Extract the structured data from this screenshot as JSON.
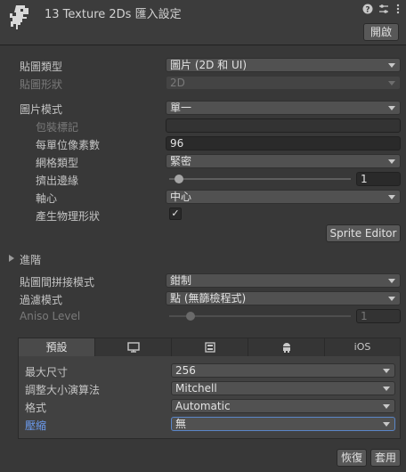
{
  "header": {
    "title": "13 Texture 2Ds 匯入設定",
    "open_label": "開啟",
    "icons": [
      "help-icon",
      "preset-icon",
      "more-icon"
    ]
  },
  "texture_type": {
    "label": "貼圖類型",
    "value": "圖片 (2D 和 UI)"
  },
  "texture_shape": {
    "label": "貼圖形狀",
    "value": "2D"
  },
  "sprite_mode": {
    "label": "圖片模式",
    "value": "單一"
  },
  "packing_tag": {
    "label": "包裝標記",
    "value": ""
  },
  "pixels_per_unit": {
    "label": "每單位像素數",
    "value": "96"
  },
  "mesh_type": {
    "label": "網格類型",
    "value": "緊密"
  },
  "extrude_edges": {
    "label": "擠出邊緣",
    "value": "1",
    "slider_fraction": 0.03
  },
  "pivot": {
    "label": "軸心",
    "value": "中心"
  },
  "generate_physics_shape": {
    "label": "產生物理形狀",
    "checked": true,
    "check_glyph": "✓"
  },
  "sprite_editor_label": "Sprite Editor",
  "advanced_label": "進階",
  "wrap_mode": {
    "label": "貼圖間拼接模式",
    "value": "鉗制"
  },
  "filter_mode": {
    "label": "過濾模式",
    "value": "點 (無篩檢程式)"
  },
  "aniso_level": {
    "label": "Aniso Level",
    "value": "1",
    "slider_fraction": 0.1
  },
  "platform_tabs": [
    {
      "label": "預設",
      "icon": "",
      "active": true
    },
    {
      "label": "",
      "icon": "monitor-icon"
    },
    {
      "label": "",
      "icon": "webgl-icon"
    },
    {
      "label": "",
      "icon": "android-icon"
    },
    {
      "label": "iOS",
      "icon": ""
    }
  ],
  "max_size": {
    "label": "最大尺寸",
    "value": "256"
  },
  "resize_algorithm": {
    "label": "調整大小演算法",
    "value": "Mitchell"
  },
  "format": {
    "label": "格式",
    "value": "Automatic"
  },
  "compression": {
    "label": "壓縮",
    "value": "無"
  },
  "footer": {
    "revert_label": "恢復",
    "apply_label": "套用"
  },
  "colors": {
    "highlight_label": "#6c9cf0",
    "background": "#383838"
  }
}
